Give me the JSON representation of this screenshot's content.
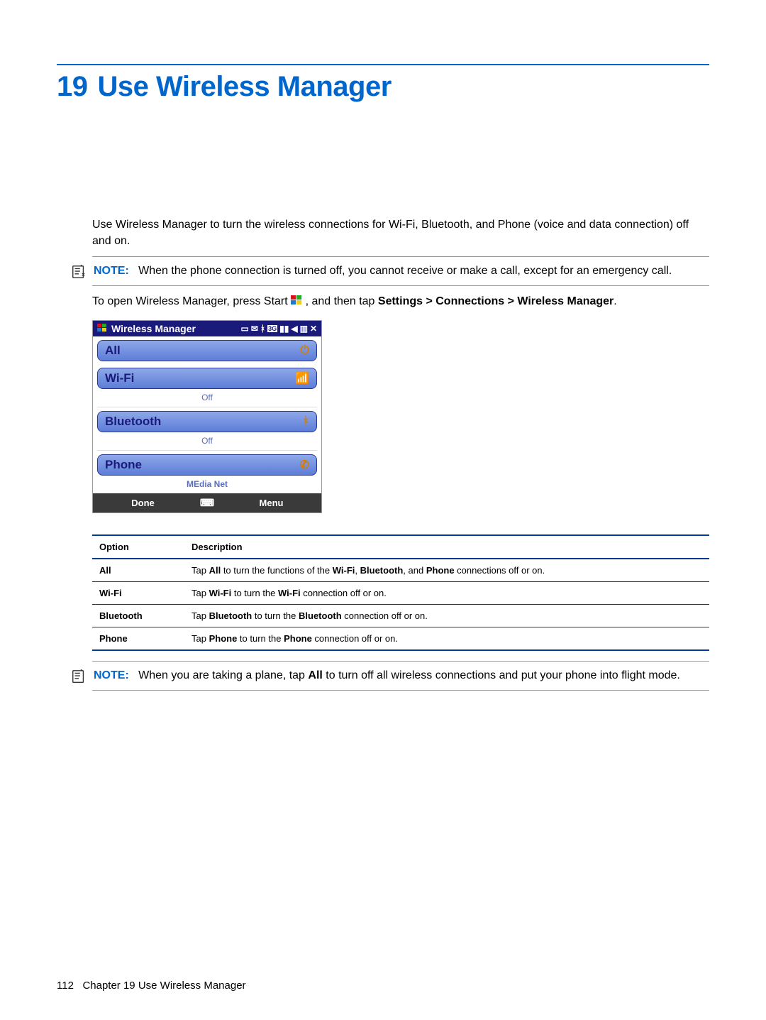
{
  "chapter": {
    "number": "19",
    "title": "Use Wireless Manager"
  },
  "intro": "Use Wireless Manager to turn the wireless connections for Wi-Fi, Bluetooth, and Phone (voice and data connection) off and on.",
  "note1": {
    "label": "NOTE:",
    "text": "When the phone connection is turned off, you cannot receive or make a call, except for an emergency call."
  },
  "open_steps": {
    "pre": "To open Wireless Manager, press Start ",
    "mid": ", and then tap ",
    "bold": "Settings > Connections > Wireless Manager",
    "after": "."
  },
  "screenshot": {
    "title": "Wireless Manager",
    "rows": {
      "all": "All",
      "wifi": "Wi-Fi",
      "wifi_status": "Off",
      "bluetooth": "Bluetooth",
      "bluetooth_status": "Off",
      "phone": "Phone",
      "phone_status": "MEdia Net"
    },
    "bottom": {
      "left": "Done",
      "right": "Menu"
    }
  },
  "table": {
    "headers": {
      "option": "Option",
      "description": "Description"
    },
    "rows": [
      {
        "option": "All",
        "desc_parts": [
          "Tap ",
          "All",
          " to turn the functions of the ",
          "Wi-Fi",
          ", ",
          "Bluetooth",
          ", and ",
          "Phone",
          " connections off or on."
        ]
      },
      {
        "option": "Wi-Fi",
        "desc_parts": [
          "Tap ",
          "Wi-Fi",
          " to turn the ",
          "Wi-Fi",
          " connection off or on."
        ]
      },
      {
        "option": "Bluetooth",
        "desc_parts": [
          "Tap ",
          "Bluetooth",
          " to turn the ",
          "Bluetooth",
          " connection off or on."
        ]
      },
      {
        "option": "Phone",
        "desc_parts": [
          "Tap ",
          "Phone",
          " to turn the ",
          "Phone",
          " connection off or on."
        ]
      }
    ]
  },
  "note2": {
    "label": "NOTE:",
    "pre": "When you are taking a plane, tap ",
    "bold": "All",
    "post": " to turn off all wireless connections and put your phone into flight mode."
  },
  "footer": {
    "page": "112",
    "text": "Chapter 19   Use Wireless Manager"
  }
}
